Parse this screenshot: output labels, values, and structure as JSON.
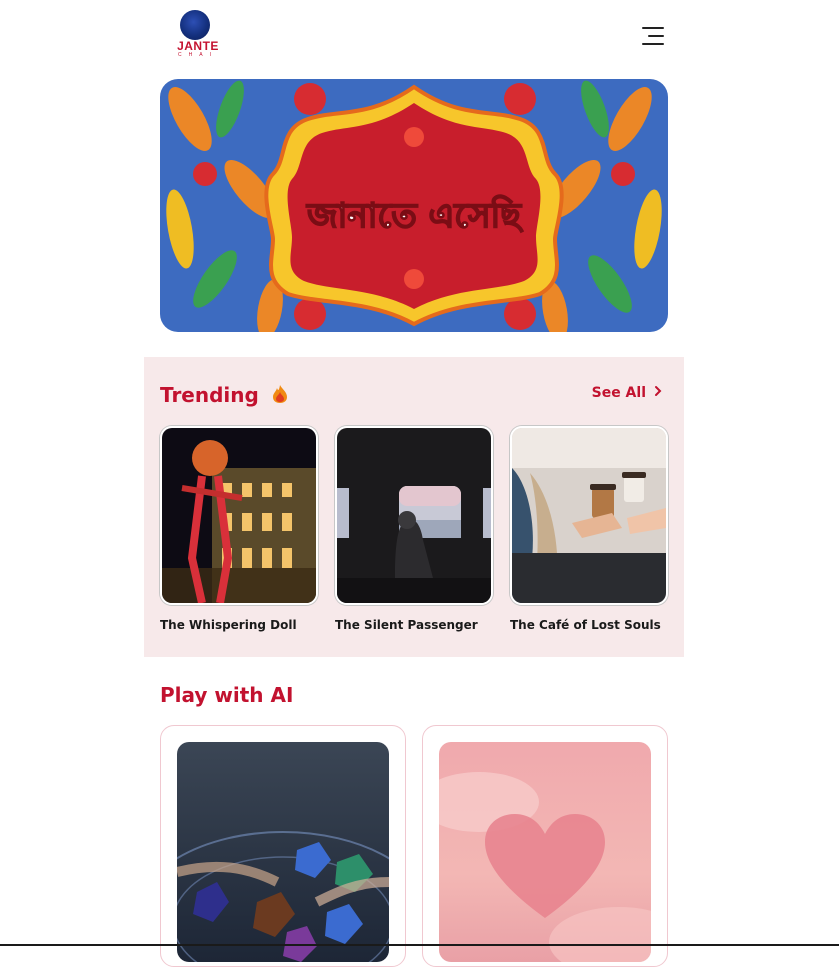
{
  "header": {
    "logo_text": "JANTE",
    "logo_sub": "CHAI",
    "menu_icon": "hamburger-icon"
  },
  "banner": {
    "text": "জানাতে এসেছি"
  },
  "trending": {
    "title": "Trending",
    "title_icon": "fire-icon",
    "see_all_label": "See All",
    "see_all_icon": "chevron-right-icon",
    "items": [
      {
        "title": "The Whispering Doll"
      },
      {
        "title": "The Silent Passenger"
      },
      {
        "title": "The Café of Lost Souls"
      }
    ]
  },
  "play_with_ai": {
    "title": "Play with AI"
  },
  "colors": {
    "brand_red": "#c2122f",
    "trending_bg": "#f7e9ea",
    "card_border": "#f0c8d0"
  }
}
